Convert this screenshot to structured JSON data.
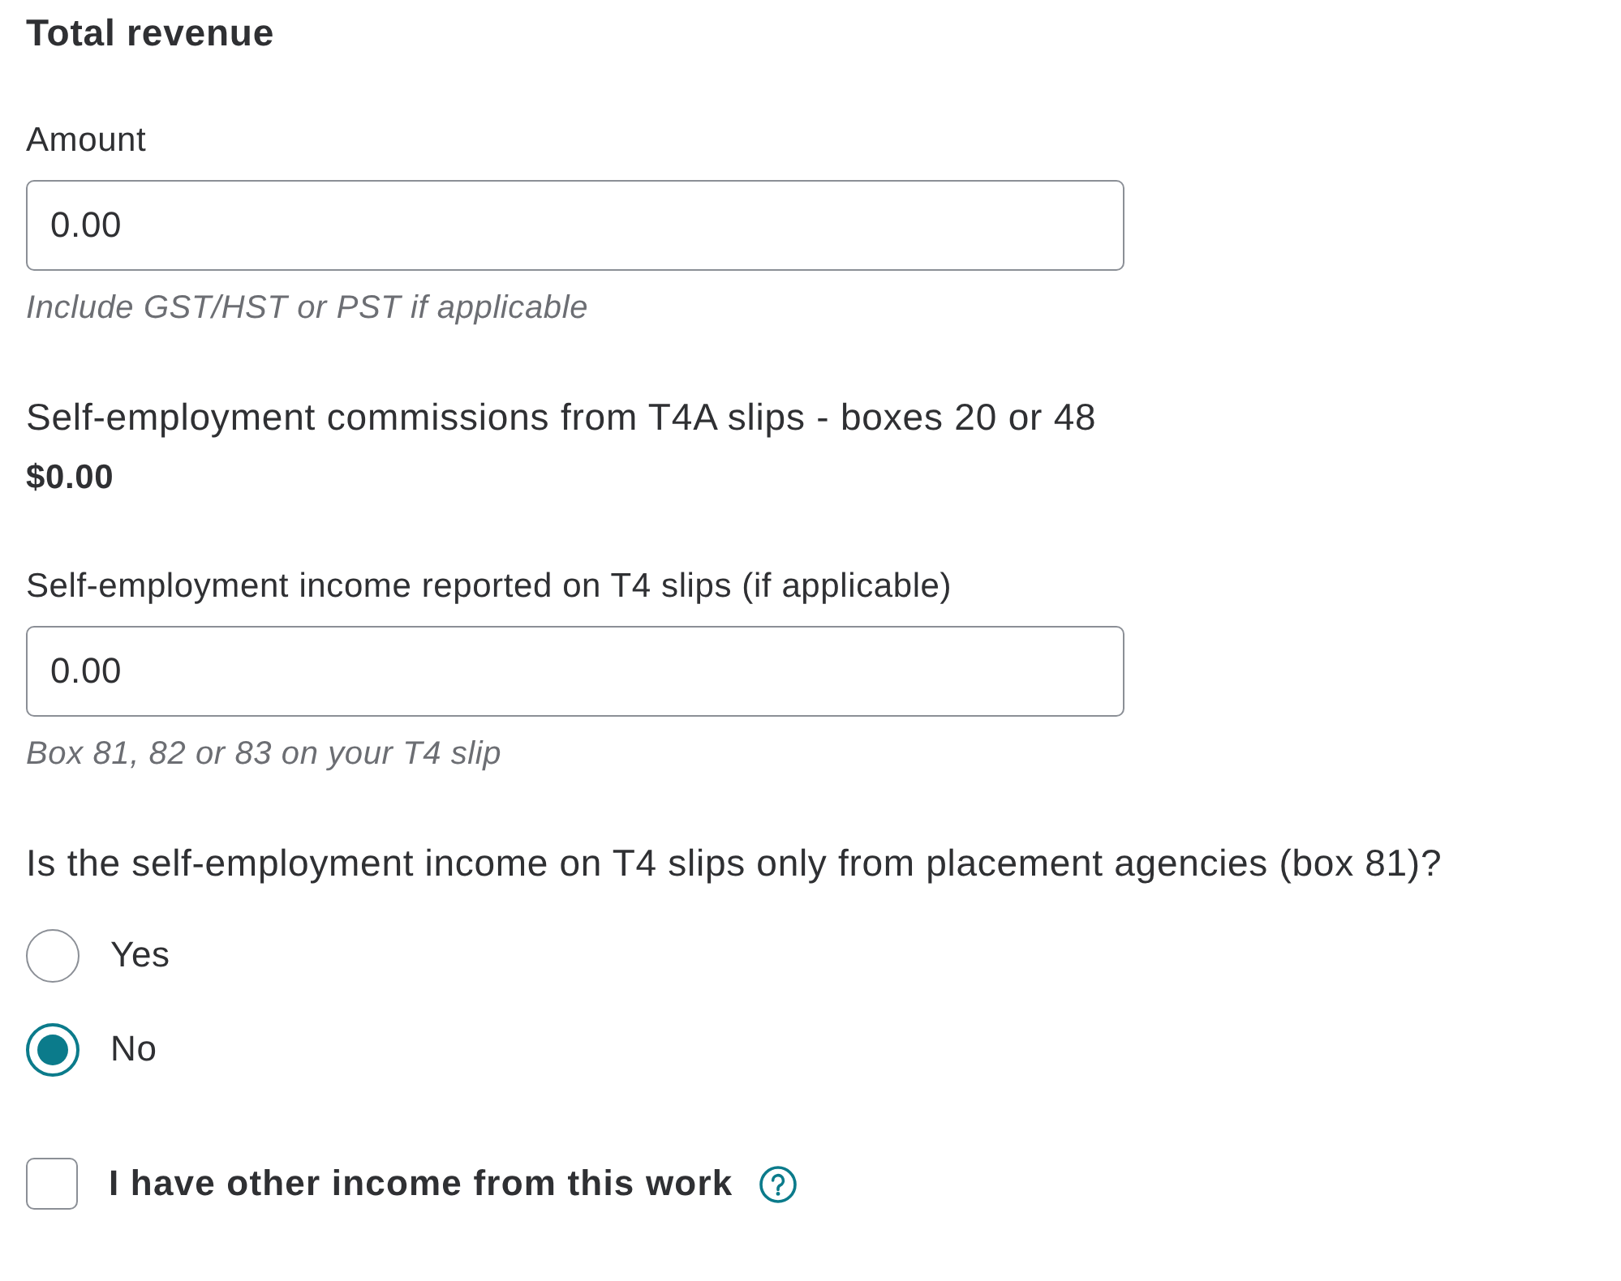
{
  "heading": "Total revenue",
  "fields": [
    {
      "kind": "input",
      "label": "Amount",
      "value": "0.00",
      "hint": "Include GST/HST or PST if applicable"
    },
    {
      "kind": "display",
      "label": "Self-employment commissions from T4A slips - boxes 20 or 48",
      "value": "$0.00"
    },
    {
      "kind": "input",
      "label": "Self-employment income reported on T4 slips (if applicable)",
      "value": "0.00",
      "hint": "Box 81, 82 or 83 on your T4 slip"
    }
  ],
  "question": {
    "text": "Is the self-employment income on T4 slips only from placement agencies (box 81)?",
    "options": [
      {
        "label": "Yes",
        "selected": false
      },
      {
        "label": "No",
        "selected": true
      }
    ]
  },
  "other_income": {
    "label": "I have other income from this work",
    "checked": false
  }
}
